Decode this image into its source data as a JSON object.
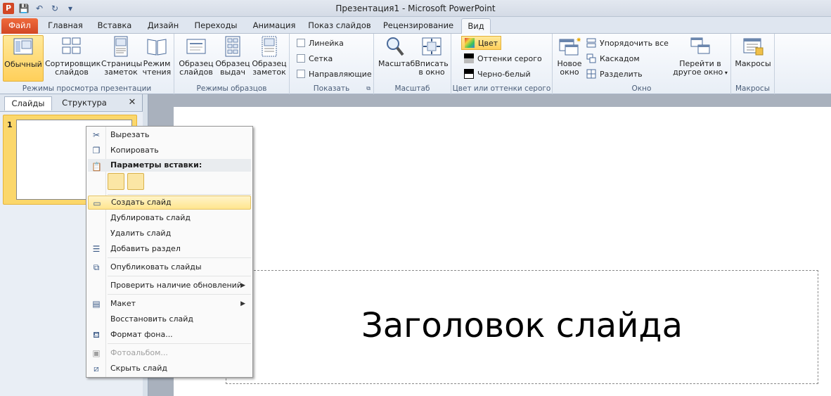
{
  "window": {
    "title": "Презентация1 - Microsoft PowerPoint"
  },
  "app_icon": "P",
  "tabs": [
    {
      "label": "Файл"
    },
    {
      "label": "Главная"
    },
    {
      "label": "Вставка"
    },
    {
      "label": "Дизайн"
    },
    {
      "label": "Переходы"
    },
    {
      "label": "Анимация"
    },
    {
      "label": "Показ слайдов"
    },
    {
      "label": "Рецензирование"
    },
    {
      "label": "Вид"
    }
  ],
  "ribbon": {
    "view_modes": {
      "label": "Режимы просмотра презентации",
      "normal": "Обычный",
      "sorter": [
        "Сортировщик",
        "слайдов"
      ],
      "notes": [
        "Страницы",
        "заметок"
      ],
      "reading": [
        "Режим",
        "чтения"
      ]
    },
    "masters": {
      "label": "Режимы образцов",
      "slide_master": [
        "Образец",
        "слайдов"
      ],
      "handout_master": [
        "Образец",
        "выдач"
      ],
      "notes_master": [
        "Образец",
        "заметок"
      ]
    },
    "show": {
      "label": "Показать",
      "ruler": "Линейка",
      "grid": "Сетка",
      "guides": "Направляющие"
    },
    "zoom": {
      "label": "Масштаб",
      "zoom": "Масштаб",
      "fit": [
        "Вписать",
        "в окно"
      ]
    },
    "color": {
      "label": "Цвет или оттенки серого",
      "color": "Цвет",
      "grayscale": "Оттенки серого",
      "bw": "Черно-белый"
    },
    "window": {
      "label": "Окно",
      "new_window": [
        "Новое",
        "окно"
      ],
      "arrange_all": "Упорядочить все",
      "cascade": "Каскадом",
      "split": "Разделить",
      "switch": [
        "Перейти в",
        "другое окно"
      ]
    },
    "macros": {
      "label": "Макросы",
      "macros": "Макросы"
    }
  },
  "left_panel": {
    "tab_slides": "Слайды",
    "tab_outline": "Структура",
    "close": "✕",
    "slide_number": "1"
  },
  "slide": {
    "title_placeholder": "Заголовок слайда"
  },
  "context_menu": {
    "cut": "Вырезать",
    "copy": "Копировать",
    "paste_options": "Параметры вставки:",
    "new_slide": "Создать слайд",
    "duplicate": "Дублировать слайд",
    "delete": "Удалить слайд",
    "add_section": "Добавить раздел",
    "publish": "Опубликовать слайды",
    "check_updates": "Проверить наличие обновлений",
    "layout": "Макет",
    "reset": "Восстановить слайд",
    "format_bg": "Формат фона...",
    "photo_album": "Фотоальбом...",
    "hide": "Скрыть слайд"
  }
}
